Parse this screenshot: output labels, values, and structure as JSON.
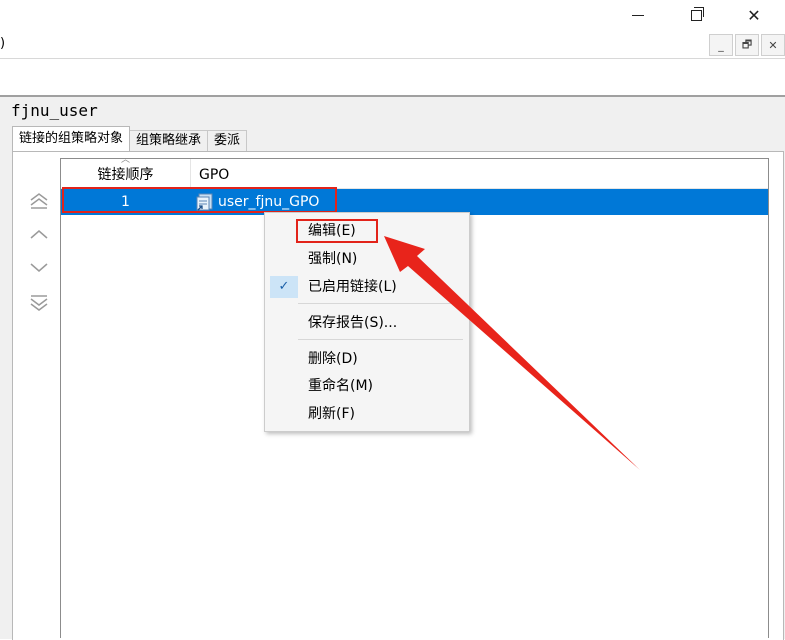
{
  "window": {
    "menu_fragment": ")",
    "minimize_glyph": "—",
    "close_glyph": "✕"
  },
  "mdi_buttons": [
    "_",
    "🗗",
    "✕"
  ],
  "pane": {
    "title": "fjnu_user",
    "tabs": [
      {
        "label": "链接的组策略对象",
        "active": true
      },
      {
        "label": "组策略继承",
        "active": false
      },
      {
        "label": "委派",
        "active": false
      }
    ]
  },
  "order_buttons": [
    "move-top-icon",
    "move-up-icon",
    "move-down-icon",
    "move-bottom-icon"
  ],
  "list": {
    "columns": [
      "链接顺序",
      "GPO"
    ],
    "rows": [
      {
        "order": "1",
        "gpo": "user_fjnu_GPO",
        "selected": true
      }
    ]
  },
  "context_menu": {
    "items": [
      {
        "label": "编辑(E)",
        "checked": false
      },
      {
        "label": "强制(N)",
        "checked": false
      },
      {
        "label": "已启用链接(L)",
        "checked": true
      },
      {
        "label": "保存报告(S)...",
        "checked": false
      },
      {
        "label": "删除(D)",
        "checked": false
      },
      {
        "label": "重命名(M)",
        "checked": false
      },
      {
        "label": "刷新(F)",
        "checked": false
      }
    ],
    "check_glyph": "✓"
  },
  "colors": {
    "selection": "#0078d7",
    "highlight_red": "#e2231a",
    "menu_bg": "#f5f5f5",
    "check_bg": "#cce4f7"
  }
}
